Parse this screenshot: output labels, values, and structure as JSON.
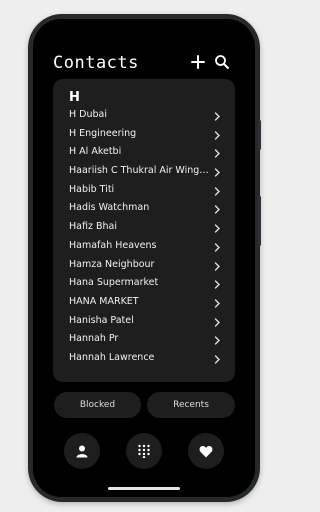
{
  "app": {
    "title": "Contacts"
  },
  "header_icons": [
    "add-icon",
    "search-icon"
  ],
  "section": {
    "letter": "H"
  },
  "contacts": [
    {
      "name": "H Dubai"
    },
    {
      "name": "H Engineering"
    },
    {
      "name": "H Al Aketbi"
    },
    {
      "name": "Haariish C Thukral Air Wings..."
    },
    {
      "name": "Habib Titi"
    },
    {
      "name": "Hadis Watchman"
    },
    {
      "name": "Hafiz Bhai"
    },
    {
      "name": "Hamafah Heavens"
    },
    {
      "name": "Hamza Neighbour"
    },
    {
      "name": "Hana Supermarket"
    },
    {
      "name": "HANA MARKET"
    },
    {
      "name": "Hanisha Patel"
    },
    {
      "name": "Hannah Pr"
    },
    {
      "name": "Hannah Lawrence"
    }
  ],
  "filters": {
    "blocked": "Blocked",
    "recents": "Recents"
  },
  "bottom_nav": [
    "person-icon",
    "dialpad-icon",
    "heart-icon"
  ],
  "colors": {
    "background": "#000000",
    "card": "#1e1e1e",
    "text": "#ffffff"
  }
}
